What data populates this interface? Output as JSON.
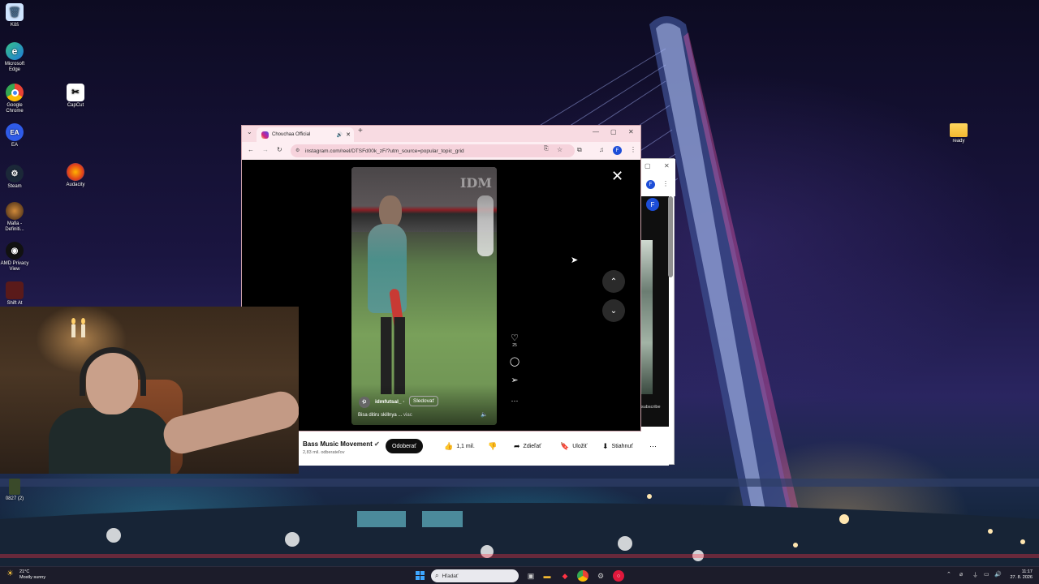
{
  "desktop": {
    "icons_left": [
      {
        "label": "Kôš",
        "icon": "recycle-bin-icon"
      },
      {
        "label": "Microsoft Edge",
        "icon": "edge-icon"
      },
      {
        "label": "Google Chrome",
        "icon": "chrome-icon"
      },
      {
        "label": "EA",
        "icon": "ea-icon"
      },
      {
        "label": "Steam",
        "icon": "steam-icon"
      },
      {
        "label": "Mafia - Definiti...",
        "icon": "mafia-icon"
      },
      {
        "label": "AMD Privacy View",
        "icon": "amd-privacy-icon"
      },
      {
        "label": "Shift At",
        "icon": "shift-at-icon"
      },
      {
        "label": "0827 (2)",
        "icon": "file-icon"
      }
    ],
    "icons_col2": [
      {
        "label": "CapCut",
        "icon": "capcut-icon"
      },
      {
        "label": "Audacity",
        "icon": "audacity-icon"
      }
    ],
    "icon_right": {
      "label": "ready",
      "icon": "folder-icon"
    }
  },
  "chrome_front": {
    "tab_title": "Chouchaa Official",
    "url": "instagram.com/reel/DTSFd00k_zF/?utm_source=popular_topic_grid",
    "profile_initial": "F",
    "reel": {
      "watermark": "IDM",
      "username": "idmfutsal_",
      "separator": "·",
      "follow_label": "Sledovať",
      "caption": "Bisa ditiru skillnya ...",
      "more_label": "viac",
      "like_count": "25"
    }
  },
  "chrome_back": {
    "profile_initial": "F",
    "side_text": "subscribe",
    "channel_name": "Bass Music Movement",
    "subscribers": "2,83 mil. odberateľov",
    "subscribe_label": "Odoberať",
    "like_label": "1,1 mil.",
    "share_label": "Zdieľať",
    "save_label": "Uložiť",
    "download_label": "Stiahnuť"
  },
  "taskbar": {
    "temperature": "21°C",
    "weather": "Mostly sunny",
    "search_placeholder": "Hľadať",
    "time": "11:17",
    "date": "27. 8. 2026"
  },
  "colors": {
    "chrome_tab_bg": "#f8dbe2",
    "subscribe_bg": "#0f0f0f",
    "accent_blue": "#1d4ed8"
  }
}
